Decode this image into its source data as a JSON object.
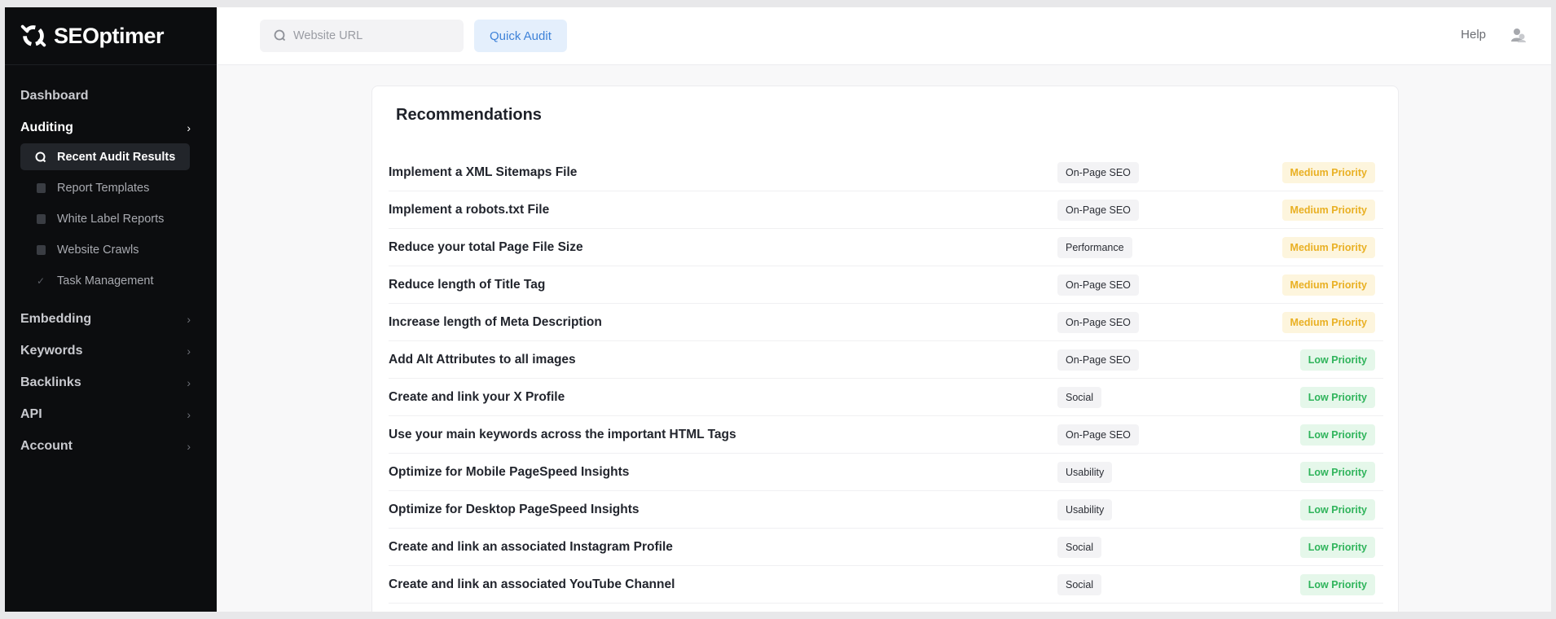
{
  "brand": {
    "name": "SEOptimer"
  },
  "sidebar": {
    "items": [
      {
        "label": "Dashboard",
        "chevron": false
      },
      {
        "label": "Auditing",
        "chevron": true,
        "active": true
      },
      {
        "label": "Embedding",
        "chevron": true
      },
      {
        "label": "Keywords",
        "chevron": true
      },
      {
        "label": "Backlinks",
        "chevron": true
      },
      {
        "label": "API",
        "chevron": true
      },
      {
        "label": "Account",
        "chevron": true
      }
    ],
    "auditing_sub": [
      {
        "label": "Recent Audit Results",
        "icon": "search-icon",
        "selected": true
      },
      {
        "label": "Report Templates",
        "icon": "template-icon"
      },
      {
        "label": "White Label Reports",
        "icon": "document-icon"
      },
      {
        "label": "Website Crawls",
        "icon": "crawl-icon"
      },
      {
        "label": "Task Management",
        "icon": "check-icon"
      }
    ]
  },
  "topbar": {
    "search_placeholder": "Website URL",
    "quick_audit_label": "Quick Audit",
    "help_label": "Help"
  },
  "recommendations": {
    "title": "Recommendations",
    "rows": [
      {
        "title": "Implement a XML Sitemaps File",
        "category": "On-Page SEO",
        "priority": "Medium Priority",
        "level": "medium"
      },
      {
        "title": "Implement a robots.txt File",
        "category": "On-Page SEO",
        "priority": "Medium Priority",
        "level": "medium"
      },
      {
        "title": "Reduce your total Page File Size",
        "category": "Performance",
        "priority": "Medium Priority",
        "level": "medium"
      },
      {
        "title": "Reduce length of Title Tag",
        "category": "On-Page SEO",
        "priority": "Medium Priority",
        "level": "medium"
      },
      {
        "title": "Increase length of Meta Description",
        "category": "On-Page SEO",
        "priority": "Medium Priority",
        "level": "medium"
      },
      {
        "title": "Add Alt Attributes to all images",
        "category": "On-Page SEO",
        "priority": "Low Priority",
        "level": "low"
      },
      {
        "title": "Create and link your X Profile",
        "category": "Social",
        "priority": "Low Priority",
        "level": "low"
      },
      {
        "title": "Use your main keywords across the important HTML Tags",
        "category": "On-Page SEO",
        "priority": "Low Priority",
        "level": "low"
      },
      {
        "title": "Optimize for Mobile PageSpeed Insights",
        "category": "Usability",
        "priority": "Low Priority",
        "level": "low"
      },
      {
        "title": "Optimize for Desktop PageSpeed Insights",
        "category": "Usability",
        "priority": "Low Priority",
        "level": "low"
      },
      {
        "title": "Create and link an associated Instagram Profile",
        "category": "Social",
        "priority": "Low Priority",
        "level": "low"
      },
      {
        "title": "Create and link an associated YouTube Channel",
        "category": "Social",
        "priority": "Low Priority",
        "level": "low"
      }
    ]
  },
  "colors": {
    "sidebar_bg": "#0c0d0f",
    "accent": "#3e82d8",
    "medium_priority": "#e9b023",
    "low_priority": "#2fb45b"
  }
}
